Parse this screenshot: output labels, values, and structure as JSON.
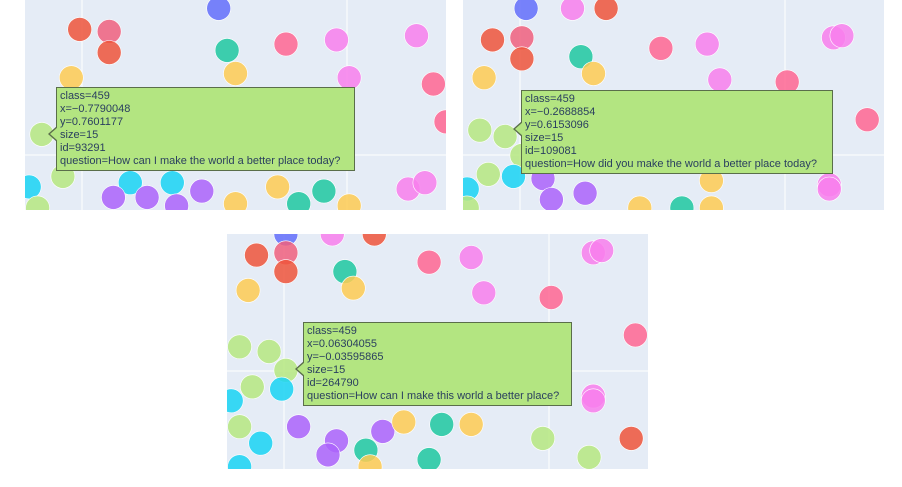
{
  "colors": {
    "plot_bg": "#e5ecf6",
    "grid": "#ffffff",
    "tooltip_bg": "#b3e581",
    "tooltip_border": "#5a6e4a",
    "tooltip_text": "#2a3f5f"
  },
  "chart_data": [
    {
      "type": "scatter",
      "grid": true,
      "hover": {
        "class_label": "class=459",
        "x_label": "x=−0.7790048",
        "y_label": "y=0.7601177",
        "size_label": "size=15",
        "id_label": "id=93291",
        "question_label": "question=How can I make the world a better place today?"
      },
      "points": [
        {
          "x": 0.46,
          "y": 0.04,
          "c": "#636efa"
        },
        {
          "x": 0.13,
          "y": 0.14,
          "c": "#ef553b"
        },
        {
          "x": 0.2,
          "y": 0.15,
          "c": "#f0607e"
        },
        {
          "x": 0.2,
          "y": 0.25,
          "c": "#ef553b"
        },
        {
          "x": 0.48,
          "y": 0.24,
          "c": "#1fc8a0"
        },
        {
          "x": 0.62,
          "y": 0.21,
          "c": "#ff6692"
        },
        {
          "x": 0.74,
          "y": 0.19,
          "c": "#f87fec"
        },
        {
          "x": 0.93,
          "y": 0.17,
          "c": "#f87fec"
        },
        {
          "x": 0.11,
          "y": 0.37,
          "c": "#fecb52"
        },
        {
          "x": 0.5,
          "y": 0.35,
          "c": "#fecb52"
        },
        {
          "x": 0.77,
          "y": 0.37,
          "c": "#f87fec"
        },
        {
          "x": 0.97,
          "y": 0.4,
          "c": "#ff6692"
        },
        {
          "x": 0.19,
          "y": 0.51,
          "c": "#ff6692"
        },
        {
          "x": 1.0,
          "y": 0.58,
          "c": "#ff6692"
        },
        {
          "x": 0.04,
          "y": 0.64,
          "c": "#b6e880"
        },
        {
          "x": 0.12,
          "y": 0.7,
          "c": "#b6e880"
        },
        {
          "x": 0.09,
          "y": 0.84,
          "c": "#b6e880"
        },
        {
          "x": 0.01,
          "y": 0.89,
          "c": "#19d3f3"
        },
        {
          "x": 0.25,
          "y": 0.87,
          "c": "#19d3f3"
        },
        {
          "x": 0.35,
          "y": 0.87,
          "c": "#19d3f3"
        },
        {
          "x": 0.42,
          "y": 0.91,
          "c": "#ab63fa"
        },
        {
          "x": 0.6,
          "y": 0.89,
          "c": "#fecb52"
        },
        {
          "x": 0.71,
          "y": 0.91,
          "c": "#1fc8a0"
        },
        {
          "x": 0.91,
          "y": 0.9,
          "c": "#f87fec"
        },
        {
          "x": 0.95,
          "y": 0.87,
          "c": "#f87fec"
        },
        {
          "x": 0.21,
          "y": 0.94,
          "c": "#ab63fa"
        },
        {
          "x": 0.29,
          "y": 0.94,
          "c": "#ab63fa"
        },
        {
          "x": 0.36,
          "y": 0.98,
          "c": "#ab63fa"
        },
        {
          "x": 0.5,
          "y": 0.97,
          "c": "#fecb52"
        },
        {
          "x": 0.65,
          "y": 0.97,
          "c": "#1fc8a0"
        },
        {
          "x": 0.77,
          "y": 0.98,
          "c": "#fecb52"
        },
        {
          "x": 0.03,
          "y": 0.99,
          "c": "#b6e880"
        }
      ]
    },
    {
      "type": "scatter",
      "grid": true,
      "hover": {
        "class_label": "class=459",
        "x_label": "x=−0.2688854",
        "y_label": "y=0.6153096",
        "size_label": "size=15",
        "id_label": "id=109081",
        "question_label": "question=How did you make the world a better place today?"
      },
      "points": [
        {
          "x": 0.15,
          "y": 0.04,
          "c": "#636efa"
        },
        {
          "x": 0.26,
          "y": 0.04,
          "c": "#f87fec"
        },
        {
          "x": 0.34,
          "y": 0.04,
          "c": "#ef553b"
        },
        {
          "x": 0.07,
          "y": 0.19,
          "c": "#ef553b"
        },
        {
          "x": 0.14,
          "y": 0.18,
          "c": "#f0607e"
        },
        {
          "x": 0.14,
          "y": 0.28,
          "c": "#ef553b"
        },
        {
          "x": 0.28,
          "y": 0.27,
          "c": "#1fc8a0"
        },
        {
          "x": 0.47,
          "y": 0.23,
          "c": "#ff6692"
        },
        {
          "x": 0.58,
          "y": 0.21,
          "c": "#f87fec"
        },
        {
          "x": 0.88,
          "y": 0.18,
          "c": "#f87fec"
        },
        {
          "x": 0.9,
          "y": 0.17,
          "c": "#f87fec"
        },
        {
          "x": 0.05,
          "y": 0.37,
          "c": "#fecb52"
        },
        {
          "x": 0.31,
          "y": 0.35,
          "c": "#fecb52"
        },
        {
          "x": 0.61,
          "y": 0.38,
          "c": "#f87fec"
        },
        {
          "x": 0.77,
          "y": 0.39,
          "c": "#ff6692"
        },
        {
          "x": 0.96,
          "y": 0.57,
          "c": "#ff6692"
        },
        {
          "x": 0.04,
          "y": 0.62,
          "c": "#b6e880"
        },
        {
          "x": 0.1,
          "y": 0.65,
          "c": "#b6e880"
        },
        {
          "x": 0.14,
          "y": 0.74,
          "c": "#b6e880"
        },
        {
          "x": 0.06,
          "y": 0.83,
          "c": "#b6e880"
        },
        {
          "x": 0.12,
          "y": 0.84,
          "c": "#19d3f3"
        },
        {
          "x": 0.01,
          "y": 0.9,
          "c": "#19d3f3"
        },
        {
          "x": 0.19,
          "y": 0.85,
          "c": "#ab63fa"
        },
        {
          "x": 0.59,
          "y": 0.86,
          "c": "#fecb52"
        },
        {
          "x": 0.87,
          "y": 0.88,
          "c": "#f87fec"
        },
        {
          "x": 0.87,
          "y": 0.9,
          "c": "#f87fec"
        },
        {
          "x": 0.21,
          "y": 0.95,
          "c": "#ab63fa"
        },
        {
          "x": 0.29,
          "y": 0.92,
          "c": "#ab63fa"
        },
        {
          "x": 0.42,
          "y": 0.99,
          "c": "#fecb52"
        },
        {
          "x": 0.52,
          "y": 0.99,
          "c": "#1fc8a0"
        },
        {
          "x": 0.59,
          "y": 0.99,
          "c": "#fecb52"
        },
        {
          "x": 0.01,
          "y": 0.99,
          "c": "#b6e880"
        }
      ]
    },
    {
      "type": "scatter",
      "grid": true,
      "hover": {
        "class_label": "class=459",
        "x_label": "x=0.06304055",
        "y_label": "y=−0.03595865",
        "size_label": "size=15",
        "id_label": "id=264790",
        "question_label": "question=How can I make this world a better place?"
      },
      "points": [
        {
          "x": 0.14,
          "y": 0.0,
          "c": "#636efa"
        },
        {
          "x": 0.25,
          "y": 0.0,
          "c": "#f87fec"
        },
        {
          "x": 0.35,
          "y": 0.0,
          "c": "#ef553b"
        },
        {
          "x": 0.07,
          "y": 0.09,
          "c": "#ef553b"
        },
        {
          "x": 0.14,
          "y": 0.08,
          "c": "#f0607e"
        },
        {
          "x": 0.14,
          "y": 0.16,
          "c": "#ef553b"
        },
        {
          "x": 0.28,
          "y": 0.16,
          "c": "#1fc8a0"
        },
        {
          "x": 0.48,
          "y": 0.12,
          "c": "#ff6692"
        },
        {
          "x": 0.58,
          "y": 0.1,
          "c": "#f87fec"
        },
        {
          "x": 0.87,
          "y": 0.08,
          "c": "#f87fec"
        },
        {
          "x": 0.89,
          "y": 0.07,
          "c": "#f87fec"
        },
        {
          "x": 0.05,
          "y": 0.24,
          "c": "#fecb52"
        },
        {
          "x": 0.3,
          "y": 0.23,
          "c": "#fecb52"
        },
        {
          "x": 0.61,
          "y": 0.25,
          "c": "#f87fec"
        },
        {
          "x": 0.77,
          "y": 0.27,
          "c": "#ff6692"
        },
        {
          "x": 0.97,
          "y": 0.43,
          "c": "#ff6692"
        },
        {
          "x": 0.03,
          "y": 0.48,
          "c": "#b6e880"
        },
        {
          "x": 0.1,
          "y": 0.5,
          "c": "#b6e880"
        },
        {
          "x": 0.14,
          "y": 0.58,
          "c": "#b6e880"
        },
        {
          "x": 0.06,
          "y": 0.65,
          "c": "#b6e880"
        },
        {
          "x": 0.13,
          "y": 0.66,
          "c": "#19d3f3"
        },
        {
          "x": 0.01,
          "y": 0.71,
          "c": "#19d3f3"
        },
        {
          "x": 0.87,
          "y": 0.69,
          "c": "#f87fec"
        },
        {
          "x": 0.87,
          "y": 0.71,
          "c": "#f87fec"
        },
        {
          "x": 0.17,
          "y": 0.82,
          "c": "#ab63fa"
        },
        {
          "x": 0.26,
          "y": 0.88,
          "c": "#ab63fa"
        },
        {
          "x": 0.37,
          "y": 0.84,
          "c": "#ab63fa"
        },
        {
          "x": 0.42,
          "y": 0.8,
          "c": "#fecb52"
        },
        {
          "x": 0.51,
          "y": 0.81,
          "c": "#1fc8a0"
        },
        {
          "x": 0.58,
          "y": 0.81,
          "c": "#fecb52"
        },
        {
          "x": 0.03,
          "y": 0.82,
          "c": "#b6e880"
        },
        {
          "x": 0.08,
          "y": 0.89,
          "c": "#19d3f3"
        },
        {
          "x": 0.24,
          "y": 0.94,
          "c": "#ab63fa"
        },
        {
          "x": 0.33,
          "y": 0.92,
          "c": "#1fc8a0"
        },
        {
          "x": 0.48,
          "y": 0.96,
          "c": "#1fc8a0"
        },
        {
          "x": 0.75,
          "y": 0.87,
          "c": "#b6e880"
        },
        {
          "x": 0.86,
          "y": 0.95,
          "c": "#b6e880"
        },
        {
          "x": 0.96,
          "y": 0.87,
          "c": "#ef553b"
        },
        {
          "x": 0.03,
          "y": 0.99,
          "c": "#19d3f3"
        },
        {
          "x": 0.34,
          "y": 0.99,
          "c": "#fecb52"
        }
      ]
    }
  ]
}
